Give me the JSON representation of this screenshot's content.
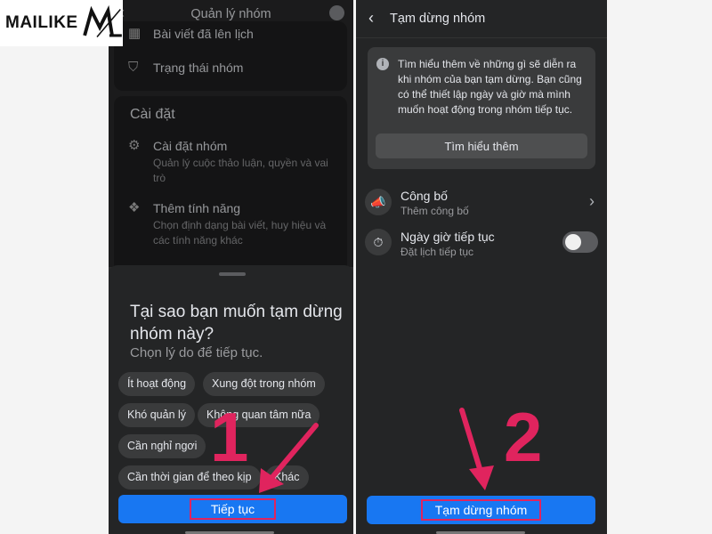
{
  "logo": {
    "text": "MAILIKE"
  },
  "left_screen": {
    "header_title": "Quản lý nhóm",
    "top_items": [
      {
        "label": "Bài viết đã lên lịch",
        "icon": "calendar-icon"
      },
      {
        "label": "Trạng thái nhóm",
        "icon": "shield-icon"
      }
    ],
    "settings_section": {
      "title": "Cài đặt",
      "items": [
        {
          "title": "Cài đặt nhóm",
          "desc": "Quản lý cuộc thảo luận, quyền và vai trò",
          "icon": "gear-icon"
        },
        {
          "title": "Thêm tính năng",
          "desc": "Chọn định dạng bài viết, huy hiệu và các tính năng khác",
          "icon": "features-icon"
        }
      ]
    },
    "sheet": {
      "title": "Tại sao bạn muốn tạm dừng nhóm này?",
      "subtitle": "Chọn lý do để tiếp tục.",
      "chips": [
        "Ít hoạt động",
        "Xung đột trong nhóm",
        "Khó quản lý",
        "Không quan tâm nữa",
        "Cần nghỉ ngơi",
        "Cần thời gian để theo kịp",
        "Khác"
      ],
      "button": "Tiếp tục"
    },
    "annotation_number": "1"
  },
  "right_screen": {
    "header_title": "Tạm dừng nhóm",
    "info_text": "Tìm hiểu thêm về những gì sẽ diễn ra khi nhóm của bạn tạm dừng. Bạn cũng có thể thiết lập ngày và giờ mà mình muốn hoạt động trong nhóm tiếp tục.",
    "learn_more_button": "Tìm hiểu thêm",
    "options": [
      {
        "title": "Công bố",
        "subtitle": "Thêm công bố",
        "icon": "megaphone-icon"
      },
      {
        "title": "Ngày giờ tiếp tục",
        "subtitle": "Đặt lịch tiếp tục",
        "icon": "stopwatch-icon",
        "toggle_on": false
      }
    ],
    "button": "Tạm dừng nhóm",
    "annotation_number": "2"
  },
  "colors": {
    "accent_blue": "#1877f2",
    "annotation_red": "#e0245e"
  }
}
